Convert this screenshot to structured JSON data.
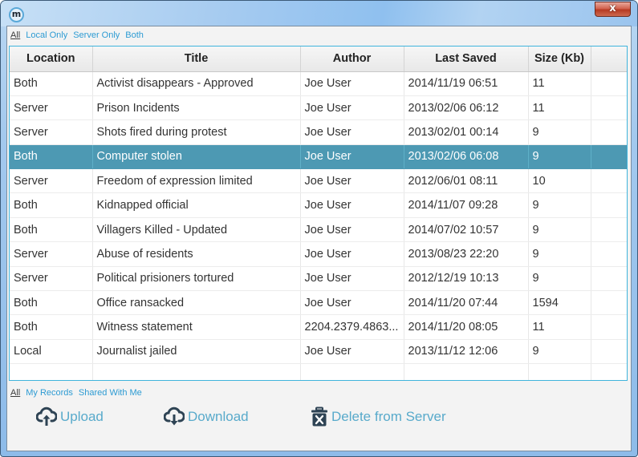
{
  "window": {
    "app_icon_letter": "m",
    "close_glyph": "x"
  },
  "location_filter": {
    "items": [
      {
        "label": "All",
        "active": true
      },
      {
        "label": "Local Only",
        "active": false
      },
      {
        "label": "Server Only",
        "active": false
      },
      {
        "label": "Both",
        "active": false
      }
    ]
  },
  "table": {
    "columns": [
      "Location",
      "Title",
      "Author",
      "Last Saved",
      "Size (Kb)",
      ""
    ],
    "selected_index": 3,
    "rows": [
      {
        "location": "Both",
        "title": "Activist disappears - Approved",
        "author": "Joe User",
        "last_saved": "2014/11/19 06:51",
        "size": "11"
      },
      {
        "location": "Server",
        "title": "Prison Incidents",
        "author": "Joe User",
        "last_saved": "2013/02/06 06:12",
        "size": "11"
      },
      {
        "location": "Server",
        "title": "Shots fired during protest",
        "author": "Joe User",
        "last_saved": "2013/02/01 00:14",
        "size": "9"
      },
      {
        "location": "Both",
        "title": "Computer stolen",
        "author": "Joe User",
        "last_saved": "2013/02/06 06:08",
        "size": "9"
      },
      {
        "location": "Server",
        "title": "Freedom of expression limited",
        "author": "Joe User",
        "last_saved": "2012/06/01 08:11",
        "size": "10"
      },
      {
        "location": "Both",
        "title": "Kidnapped official",
        "author": "Joe User",
        "last_saved": "2014/11/07 09:28",
        "size": "9"
      },
      {
        "location": "Both",
        "title": "Villagers Killed - Updated",
        "author": "Joe User",
        "last_saved": "2014/07/02 10:57",
        "size": "9"
      },
      {
        "location": "Server",
        "title": "Abuse of residents",
        "author": "Joe User",
        "last_saved": "2013/08/23 22:20",
        "size": "9"
      },
      {
        "location": "Server",
        "title": "Political prisioners tortured",
        "author": "Joe User",
        "last_saved": "2012/12/19 10:13",
        "size": "9"
      },
      {
        "location": "Both",
        "title": "Office ransacked",
        "author": "Joe User",
        "last_saved": "2014/11/20 07:44",
        "size": "1594"
      },
      {
        "location": "Both",
        "title": "Witness statement",
        "author": "2204.2379.4863...",
        "last_saved": "2014/11/20 08:05",
        "size": "11"
      },
      {
        "location": "Local",
        "title": "Journalist jailed",
        "author": "Joe User",
        "last_saved": "2013/11/12 12:06",
        "size": "9"
      },
      {
        "location": "",
        "title": "",
        "author": "",
        "last_saved": "",
        "size": ""
      }
    ]
  },
  "owner_filter": {
    "items": [
      {
        "label": "All",
        "active": true
      },
      {
        "label": "My Records",
        "active": false
      },
      {
        "label": "Shared With Me",
        "active": false
      }
    ]
  },
  "actions": {
    "upload": {
      "label": "Upload",
      "icon": "cloud-upload-icon"
    },
    "download": {
      "label": "Download",
      "icon": "cloud-download-icon"
    },
    "delete": {
      "label": "Delete from Server",
      "icon": "trash-x-icon"
    }
  },
  "colors": {
    "link": "#2d9bd3",
    "action_text": "#58aacb",
    "icon_dark": "#2e4354",
    "selected_row": "#4d99b3",
    "table_border": "#3fb4dc"
  }
}
